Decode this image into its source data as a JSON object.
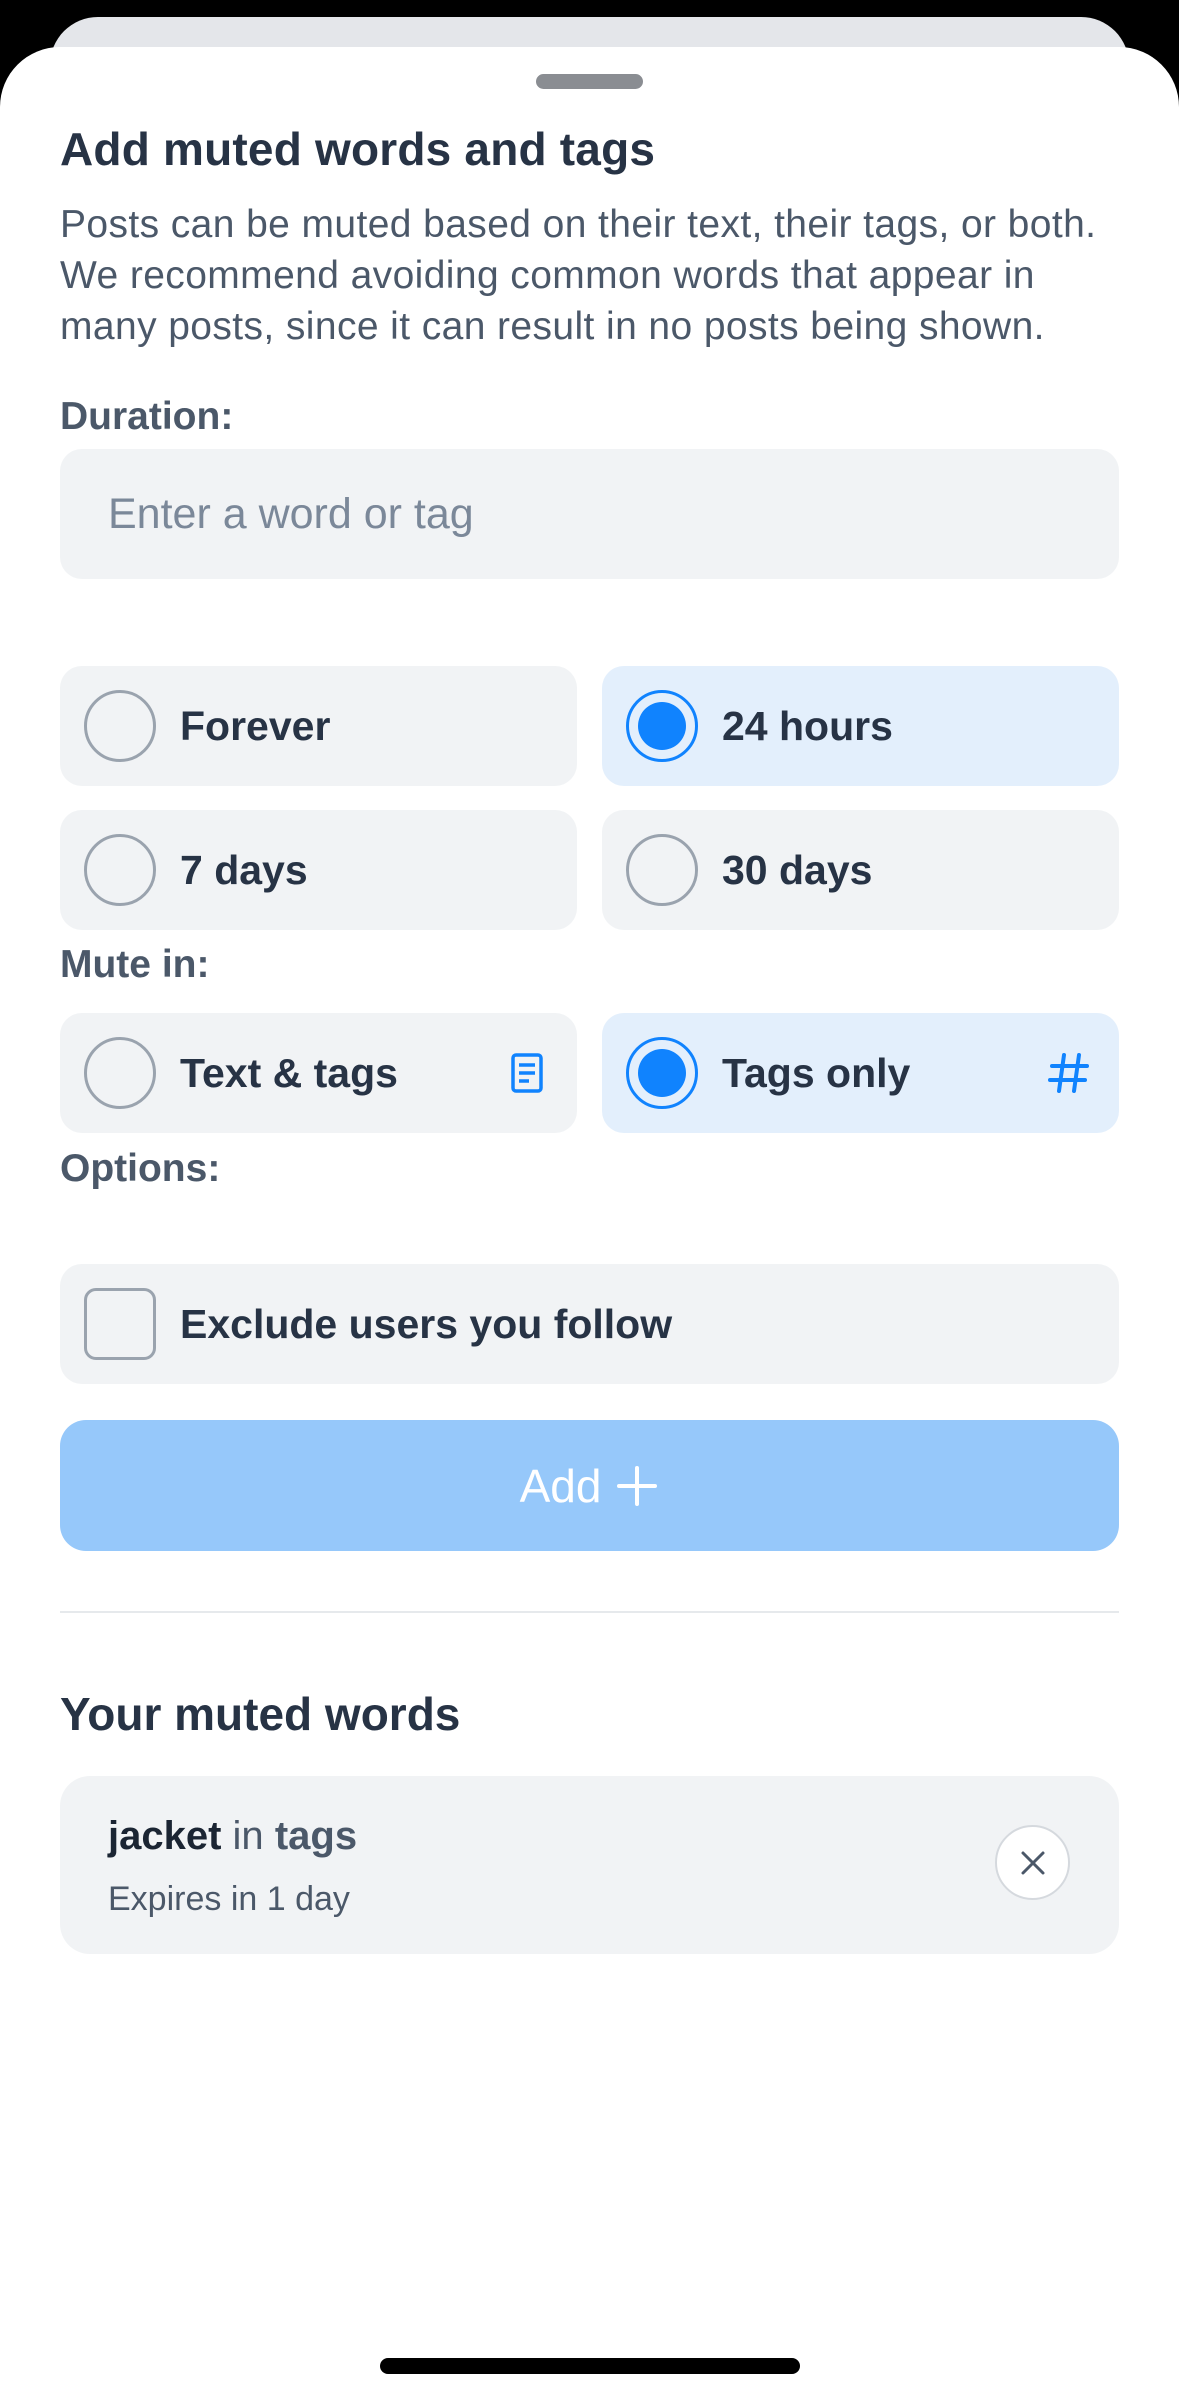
{
  "sheet": {
    "title": "Add muted words and tags",
    "description": "Posts can be muted based on their text, their tags, or both. We recommend avoiding common words that appear in many posts, since it can result in no posts being shown."
  },
  "input": {
    "placeholder": "Enter a word or tag",
    "value": ""
  },
  "duration": {
    "label": "Duration:",
    "options": [
      {
        "label": "Forever",
        "selected": false
      },
      {
        "label": "24 hours",
        "selected": true
      },
      {
        "label": "7 days",
        "selected": false
      },
      {
        "label": "30 days",
        "selected": false
      }
    ]
  },
  "mute_in": {
    "label": "Mute in:",
    "options": [
      {
        "label": "Text & tags",
        "selected": false,
        "icon": "document-icon"
      },
      {
        "label": "Tags only",
        "selected": true,
        "icon": "hashtag-icon"
      }
    ]
  },
  "options": {
    "label": "Options:",
    "exclude_following": {
      "label": "Exclude users you follow",
      "checked": false
    }
  },
  "add_button": {
    "label": "Add",
    "icon": "plus-icon"
  },
  "muted_list": {
    "title": "Your muted words",
    "items": [
      {
        "word": "jacket",
        "connector": "in",
        "scope": "tags",
        "expiry": "Expires in 1 day"
      }
    ]
  },
  "colors": {
    "accent": "#1083fe",
    "selected_bg": "#e3effc",
    "option_bg": "#f1f3f5",
    "add_button_disabled": "#96c8fa"
  }
}
